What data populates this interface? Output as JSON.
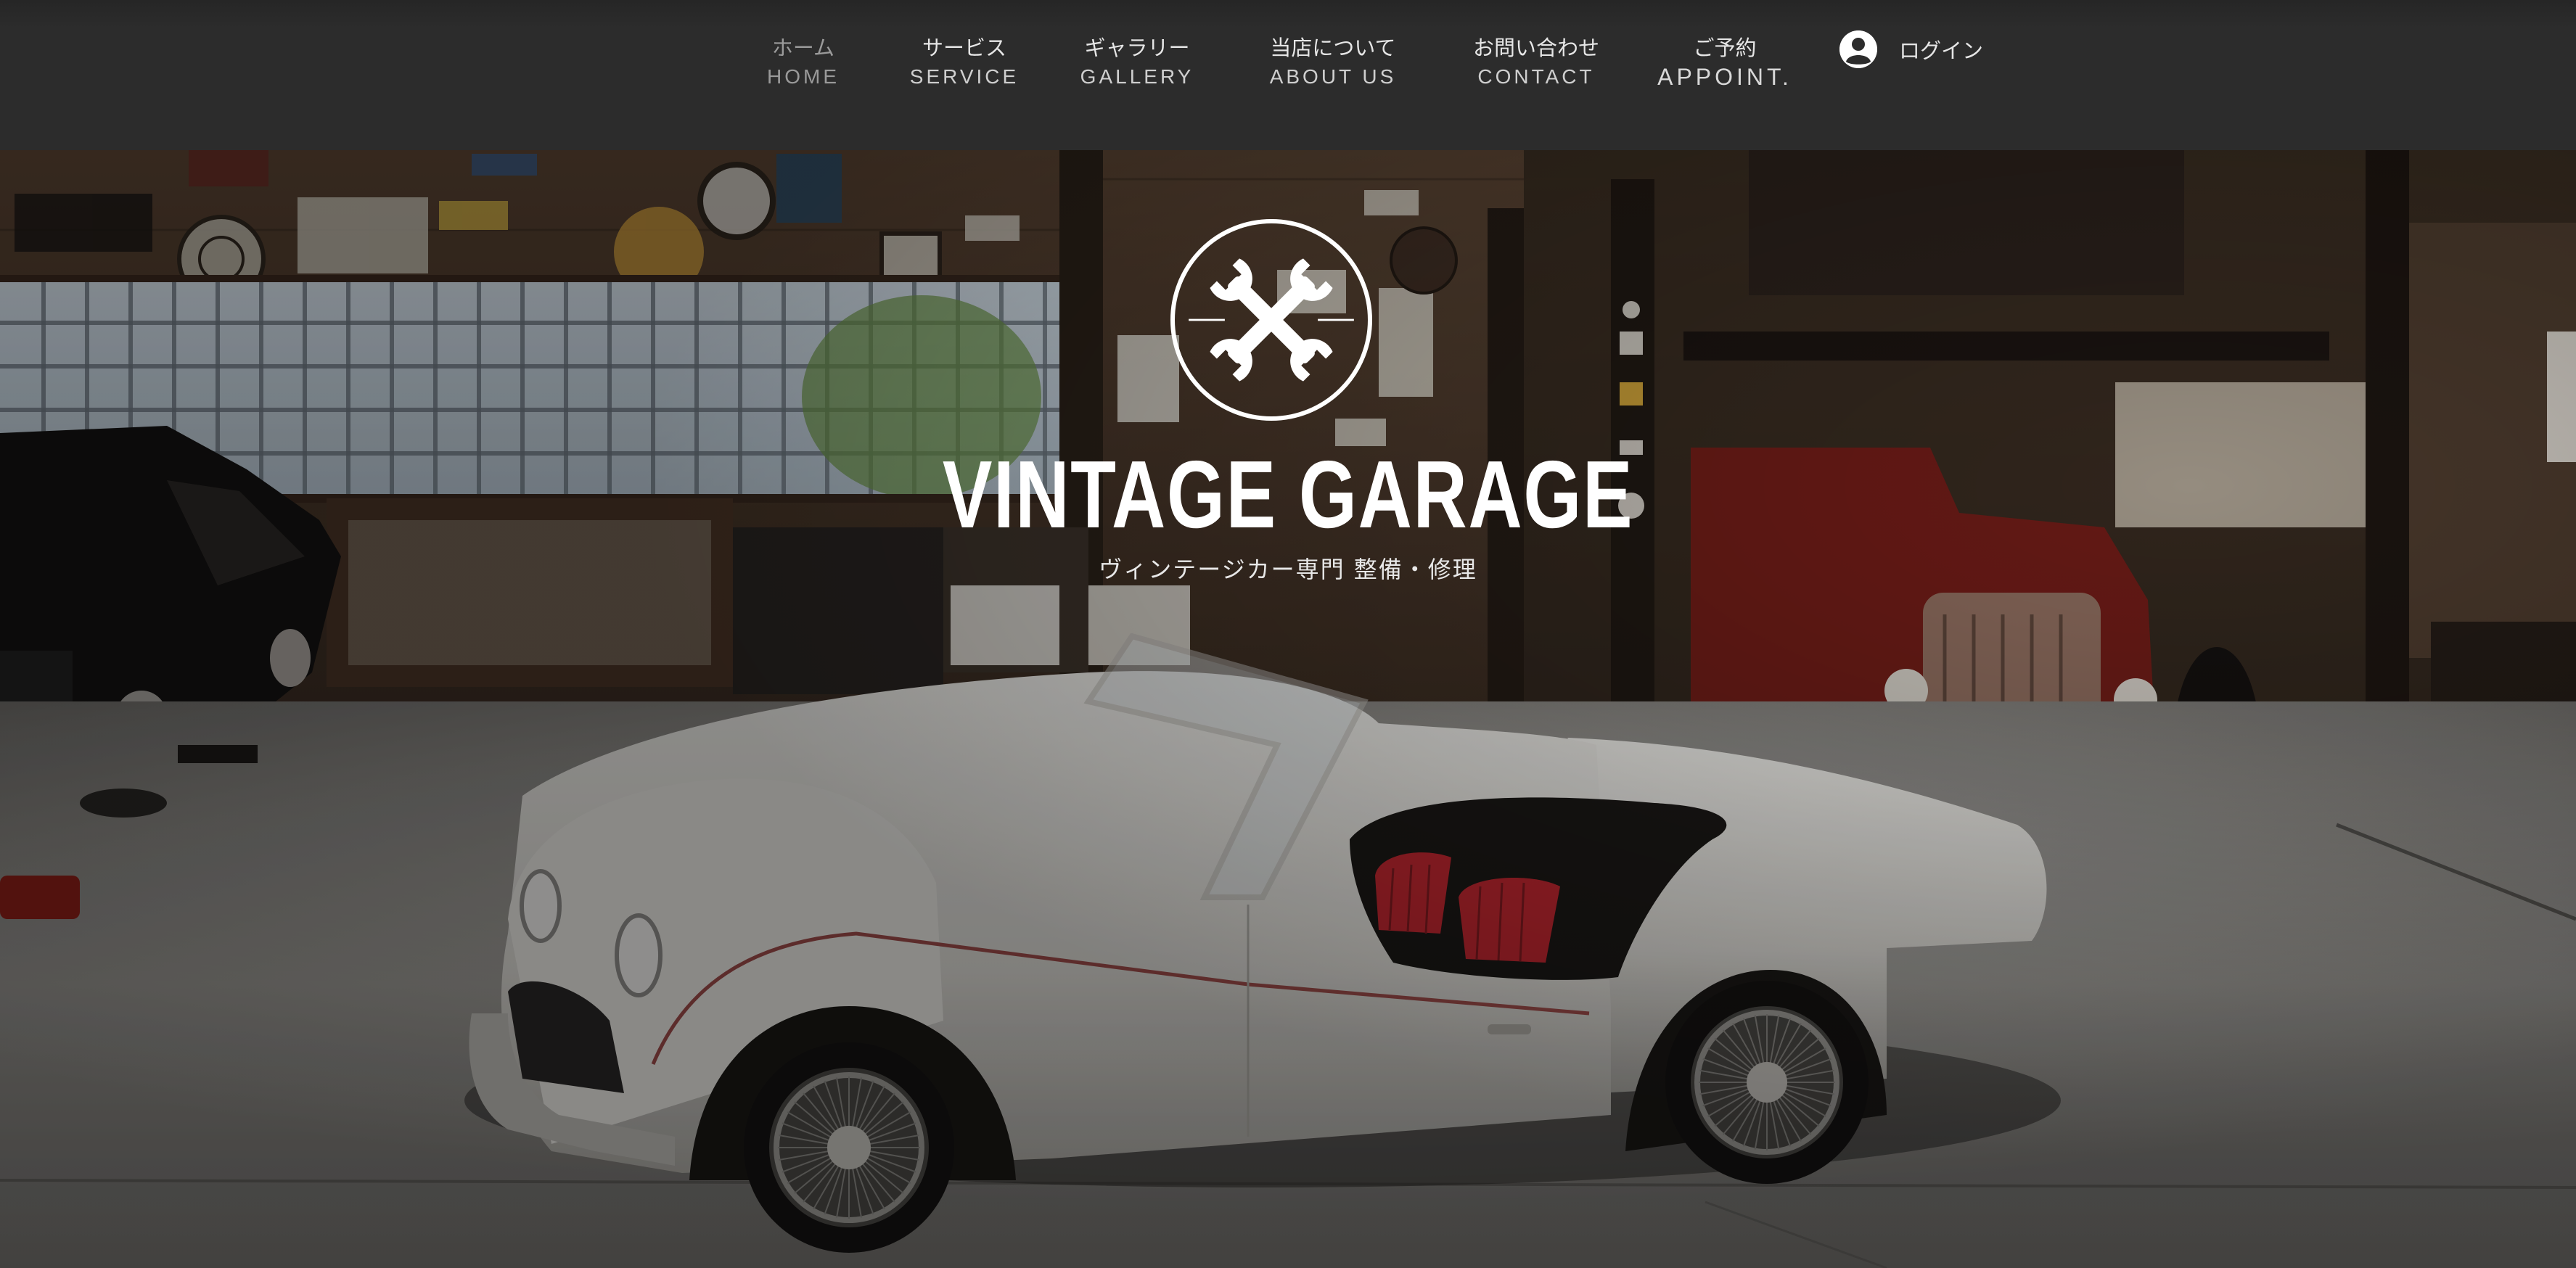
{
  "nav": {
    "items": [
      {
        "jp": "ホーム",
        "en": "HOME"
      },
      {
        "jp": "サービス",
        "en": "SERVICE"
      },
      {
        "jp": "ギャラリー",
        "en": "GALLERY"
      },
      {
        "jp": "当店について",
        "en": "ABOUT US"
      },
      {
        "jp": "お問い合わせ",
        "en": "CONTACT"
      },
      {
        "jp": "ご予約",
        "en": "APPOINT."
      }
    ],
    "active_index": 0,
    "login_label": "ログイン"
  },
  "hero": {
    "title": "VINTAGE GARAGE",
    "subtitle": "ヴィンテージカー専門 整備・修理",
    "logo_icon": "crossed-wrenches-icon"
  },
  "colors": {
    "header_bg": "#2c2c2c",
    "text": "#ffffff",
    "nav_active": "#9a9a9a",
    "car_body": "#dcdad5",
    "seat_red": "#b8262e"
  }
}
